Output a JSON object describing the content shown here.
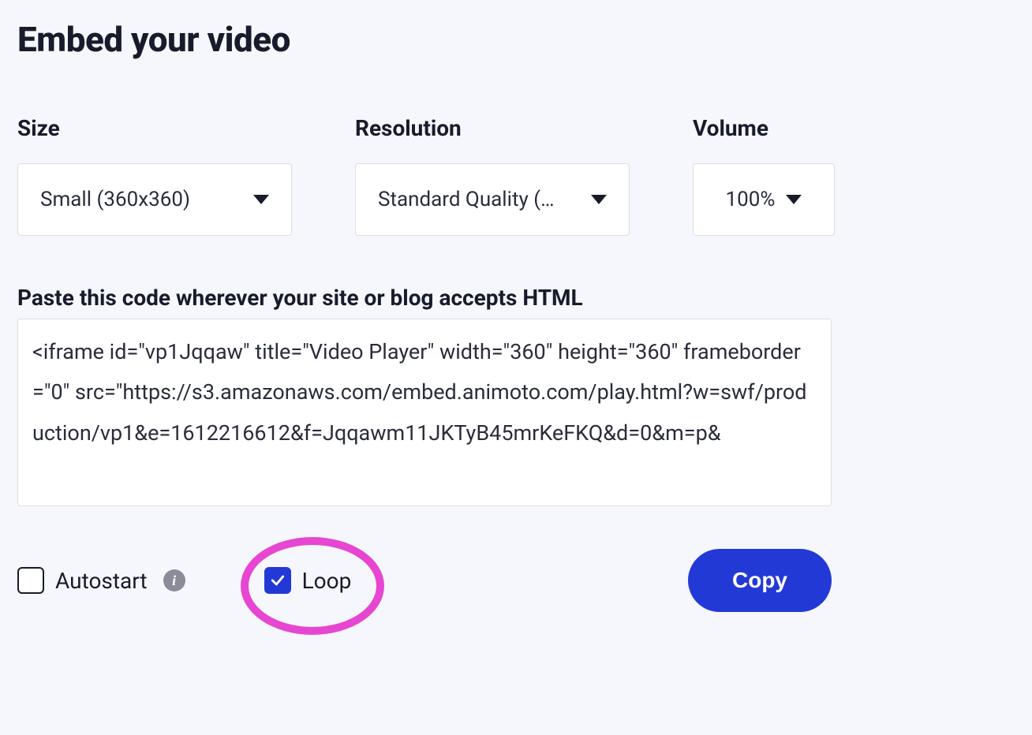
{
  "title": "Embed your video",
  "controls": {
    "size": {
      "label": "Size",
      "value": "Small (360x360)"
    },
    "resolution": {
      "label": "Resolution",
      "value": "Standard Quality (…"
    },
    "volume": {
      "label": "Volume",
      "value": "100%"
    }
  },
  "pasteLabel": "Paste this code wherever your site or blog accepts HTML",
  "embedCode": "<iframe id=\"vp1Jqqaw\" title=\"Video Player\" width=\"360\" height=\"360\" frameborder=\"0\" src=\"https://s3.amazonaws.com/embed.animoto.com/play.html?w=swf/production/vp1&e=1612216612&f=Jqqawm11JKTyB45mrKeFKQ&d=0&m=p&",
  "options": {
    "autostart": {
      "label": "Autostart",
      "checked": false
    },
    "loop": {
      "label": "Loop",
      "checked": true
    }
  },
  "copyLabel": "Copy",
  "annotation": {
    "target": "loop",
    "style": "pink-ellipse"
  }
}
